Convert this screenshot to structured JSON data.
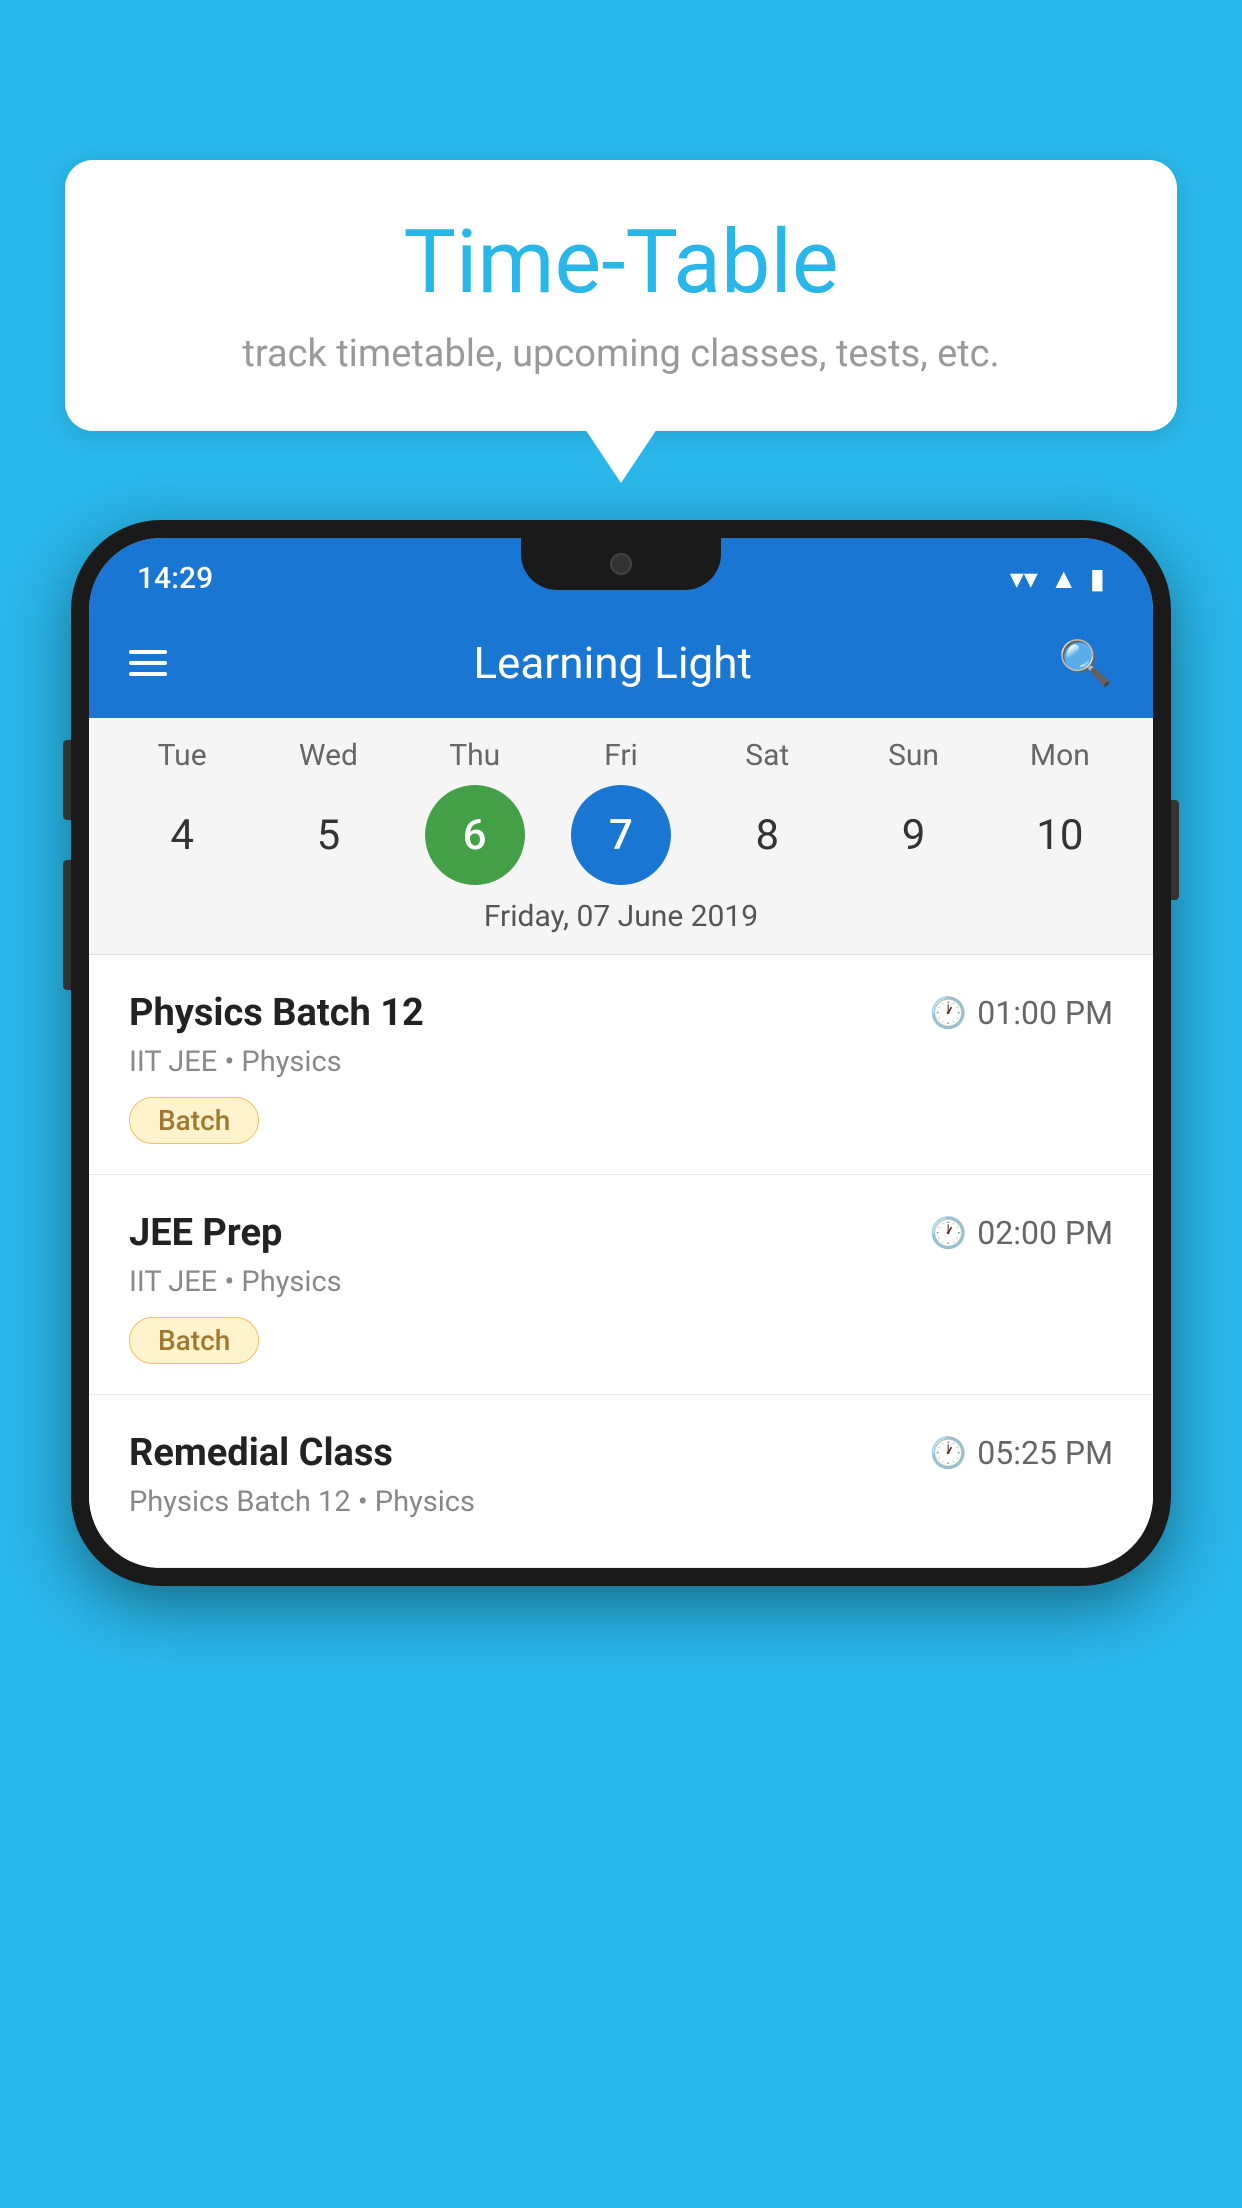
{
  "background_color": "#29b6e8",
  "speech_bubble": {
    "title": "Time-Table",
    "subtitle": "track timetable, upcoming classes, tests, etc."
  },
  "phone": {
    "status_bar": {
      "time": "14:29",
      "wifi_icon": "wifi",
      "signal_icon": "signal",
      "battery_icon": "battery"
    },
    "app_bar": {
      "title": "Learning Light",
      "menu_icon": "hamburger",
      "search_icon": "search"
    },
    "calendar": {
      "days": [
        {
          "label": "Tue",
          "number": "4"
        },
        {
          "label": "Wed",
          "number": "5"
        },
        {
          "label": "Thu",
          "number": "6",
          "state": "today"
        },
        {
          "label": "Fri",
          "number": "7",
          "state": "selected"
        },
        {
          "label": "Sat",
          "number": "8"
        },
        {
          "label": "Sun",
          "number": "9"
        },
        {
          "label": "Mon",
          "number": "10"
        }
      ],
      "selected_date": "Friday, 07 June 2019"
    },
    "classes": [
      {
        "name": "Physics Batch 12",
        "time": "01:00 PM",
        "subtitle": "IIT JEE • Physics",
        "badge": "Batch"
      },
      {
        "name": "JEE Prep",
        "time": "02:00 PM",
        "subtitle": "IIT JEE • Physics",
        "badge": "Batch"
      },
      {
        "name": "Remedial Class",
        "time": "05:25 PM",
        "subtitle": "Physics Batch 12 • Physics",
        "badge": null
      }
    ]
  }
}
